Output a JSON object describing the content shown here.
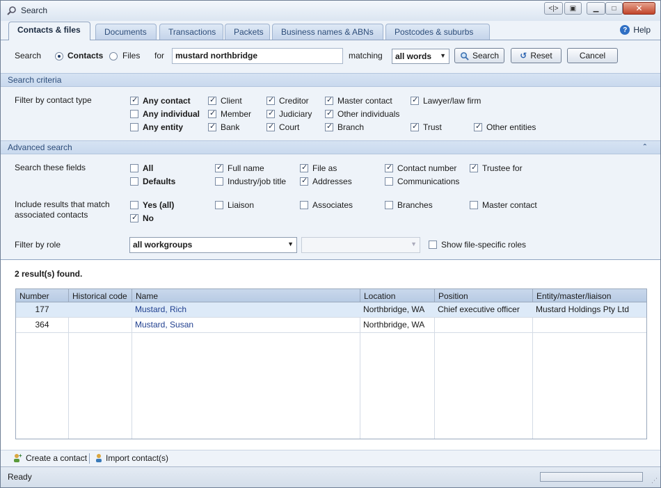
{
  "window": {
    "title": "Search"
  },
  "tabs": [
    {
      "label": "Contacts & files"
    },
    {
      "label": "Documents"
    },
    {
      "label": "Transactions"
    },
    {
      "label": "Packets"
    },
    {
      "label": "Business names & ABNs"
    },
    {
      "label": "Postcodes & suburbs"
    }
  ],
  "help_label": "Help",
  "search": {
    "label": "Search",
    "radio_contacts": "Contacts",
    "radio_files": "Files",
    "for_label": "for",
    "query": "mustard northbridge",
    "matching_label": "matching",
    "matching_value": "all words",
    "search_button": "Search",
    "reset_button": "Reset",
    "cancel_button": "Cancel"
  },
  "criteria": {
    "header": "Search criteria",
    "filter_label": "Filter by contact type",
    "contact_types": [
      {
        "label": "Any contact",
        "checked": true,
        "bold": true
      },
      {
        "label": "Client",
        "checked": true
      },
      {
        "label": "Creditor",
        "checked": true
      },
      {
        "label": "Master contact",
        "checked": true
      },
      {
        "label": "Lawyer/law firm",
        "checked": true
      },
      {
        "label": "Any individual",
        "checked": false,
        "bold": true
      },
      {
        "label": "Member",
        "checked": true
      },
      {
        "label": "Judiciary",
        "checked": true
      },
      {
        "label": "Other individuals",
        "checked": true
      },
      {
        "label": "Any entity",
        "checked": false,
        "bold": true
      },
      {
        "label": "Bank",
        "checked": true
      },
      {
        "label": "Court",
        "checked": true
      },
      {
        "label": "Branch",
        "checked": true
      },
      {
        "label": "Trust",
        "checked": true
      },
      {
        "label": "Other entities",
        "checked": true
      }
    ]
  },
  "advanced": {
    "header": "Advanced search",
    "fields_label": "Search these fields",
    "fields": [
      {
        "label": "All",
        "checked": false,
        "bold": true
      },
      {
        "label": "Full name",
        "checked": true
      },
      {
        "label": "File as",
        "checked": true
      },
      {
        "label": "Contact number",
        "checked": true
      },
      {
        "label": "Trustee for",
        "checked": true
      },
      {
        "label": "Defaults",
        "checked": false,
        "bold": true
      },
      {
        "label": "Industry/job title",
        "checked": false
      },
      {
        "label": "Addresses",
        "checked": true
      },
      {
        "label": "Communications",
        "checked": false
      }
    ],
    "include_label_1": "Include results that match",
    "include_label_2": "associated contacts",
    "include": [
      {
        "label": "Yes (all)",
        "checked": false,
        "bold": true
      },
      {
        "label": "Liaison",
        "checked": false
      },
      {
        "label": "Associates",
        "checked": false
      },
      {
        "label": "Branches",
        "checked": false
      },
      {
        "label": "Master contact",
        "checked": false
      },
      {
        "label": "No",
        "checked": true,
        "bold": true
      }
    ],
    "role_label": "Filter by role",
    "role_value": "all workgroups",
    "role_secondary": "",
    "show_file_roles": "Show file-specific roles"
  },
  "results": {
    "summary": "2 result(s) found.",
    "columns": [
      "Number",
      "Historical code",
      "Name",
      "Location",
      "Position",
      "Entity/master/liaison"
    ],
    "rows": [
      {
        "number": "177",
        "historical": "",
        "name": "Mustard, Rich",
        "location": "Northbridge, WA",
        "position": "Chief executive officer",
        "entity": "Mustard Holdings Pty Ltd"
      },
      {
        "number": "364",
        "historical": "",
        "name": "Mustard, Susan",
        "location": "Northbridge, WA",
        "position": "",
        "entity": ""
      }
    ]
  },
  "links": {
    "create": "Create a contact",
    "import": "Import contact(s)"
  },
  "status": {
    "text": "Ready"
  }
}
